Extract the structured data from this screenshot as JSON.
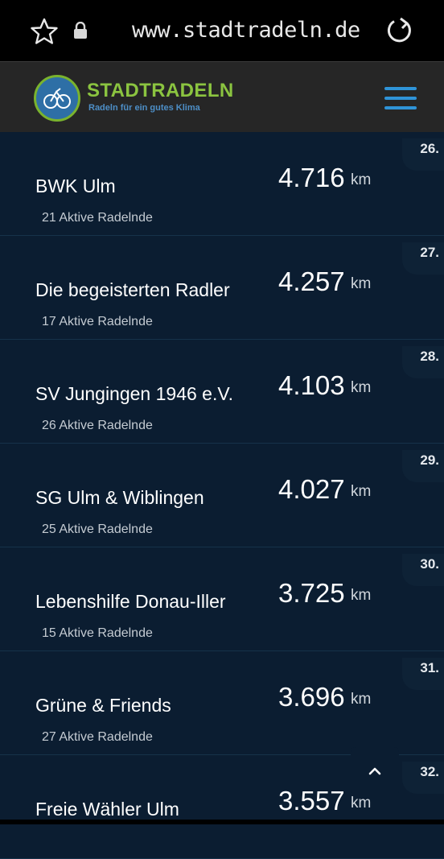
{
  "browser": {
    "url": "www.stadtradeln.de",
    "icons": [
      "star-icon",
      "lock-icon",
      "reload-icon"
    ]
  },
  "header": {
    "brand": "STADTRADELN",
    "tagline": "Radeln für ein gutes Klima",
    "menu_icon": "hamburger-menu-icon",
    "colors": {
      "brand_green": "#8bc440",
      "brand_blue": "#2f94d8",
      "header_bg": "#262626"
    }
  },
  "ranking": [
    {
      "rank": "26.",
      "team": "BWK Ulm",
      "members": "21 Aktive Radelnde",
      "km": "4.716",
      "unit": "km"
    },
    {
      "rank": "27.",
      "team": "Die begeisterten Radler",
      "members": "17 Aktive Radelnde",
      "km": "4.257",
      "unit": "km"
    },
    {
      "rank": "28.",
      "team": "SV Jungingen 1946 e.V.",
      "members": "26 Aktive Radelnde",
      "km": "4.103",
      "unit": "km"
    },
    {
      "rank": "29.",
      "team": "SG Ulm & Wiblingen",
      "members": "25 Aktive Radelnde",
      "km": "4.027",
      "unit": "km"
    },
    {
      "rank": "30.",
      "team": "Lebenshilfe Donau-Iller",
      "members": "15 Aktive Radelnde",
      "km": "3.725",
      "unit": "km"
    },
    {
      "rank": "31.",
      "team": "Grüne & Friends",
      "members": "27 Aktive Radelnde",
      "km": "3.696",
      "unit": "km"
    },
    {
      "rank": "32.",
      "team": "Freie Wähler Ulm",
      "members": "",
      "km": "3.557",
      "unit": "km"
    }
  ],
  "scroll_top_icon": "chevron-up-icon"
}
